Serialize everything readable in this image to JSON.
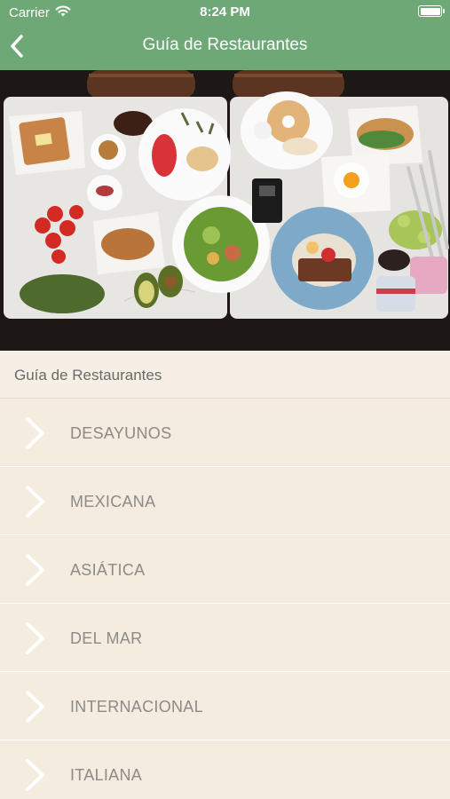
{
  "status_bar": {
    "carrier": "Carrier",
    "time": "8:24 PM",
    "battery_level": 1.0
  },
  "nav": {
    "title": "Guía de Restaurantes",
    "back_icon": "chevron-left-icon"
  },
  "hero": {
    "description_icon": "food-table-photo"
  },
  "section": {
    "header": "Guía de Restaurantes"
  },
  "categories": [
    {
      "label": "DESAYUNOS",
      "icon": "chevron-right-icon"
    },
    {
      "label": "MEXICANA",
      "icon": "chevron-right-icon"
    },
    {
      "label": "ASIÁTICA",
      "icon": "chevron-right-icon"
    },
    {
      "label": "DEL MAR",
      "icon": "chevron-right-icon"
    },
    {
      "label": "INTERNACIONAL",
      "icon": "chevron-right-icon"
    },
    {
      "label": "ITALIANA",
      "icon": "chevron-right-icon"
    }
  ],
  "colors": {
    "nav_green": "#6fa877",
    "background": "#f4ecdf",
    "label_text": "#8d8a87"
  }
}
